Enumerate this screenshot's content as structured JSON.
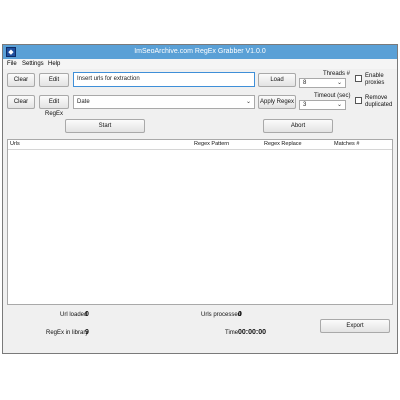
{
  "window": {
    "title": "ImSeoArchive.com RegEx Grabber V1.0.0",
    "icon": "app-icon"
  },
  "menu": [
    "File",
    "Settings",
    "Help"
  ],
  "row1": {
    "clear_label": "Clear",
    "edit_label": "Edit",
    "url_input_value": "Insert urls for extraction",
    "load_label": "Load",
    "threads_label": "Threads #",
    "threads_value": "8",
    "enable_proxies_label": "Enable proxies"
  },
  "row2": {
    "clear_label": "Clear",
    "edit_regex_label": "Edit RegEx",
    "regex_selected": "Date",
    "apply_regex_label": "Apply Regex",
    "timeout_label": "Timeout (sec)",
    "timeout_value": "3",
    "remove_duplicated_label": "Remove duplicated"
  },
  "actions": {
    "start_label": "Start",
    "abort_label": "Abort"
  },
  "table": {
    "columns": [
      "Urls",
      "Regex Pattern",
      "Regex Replace",
      "Matches #"
    ],
    "rows": []
  },
  "stats": {
    "url_loaded_label": "Url loaded",
    "url_loaded_value": "0",
    "urls_processed_label": "Urls processed",
    "urls_processed_value": "0",
    "regex_library_label": "RegEx in library",
    "regex_library_value": "9",
    "time_label": "Time",
    "time_value": "00:00:00"
  },
  "export_label": "Export",
  "colors": {
    "titlebar": "#5aa0d6",
    "focus": "#3f8fd8"
  }
}
